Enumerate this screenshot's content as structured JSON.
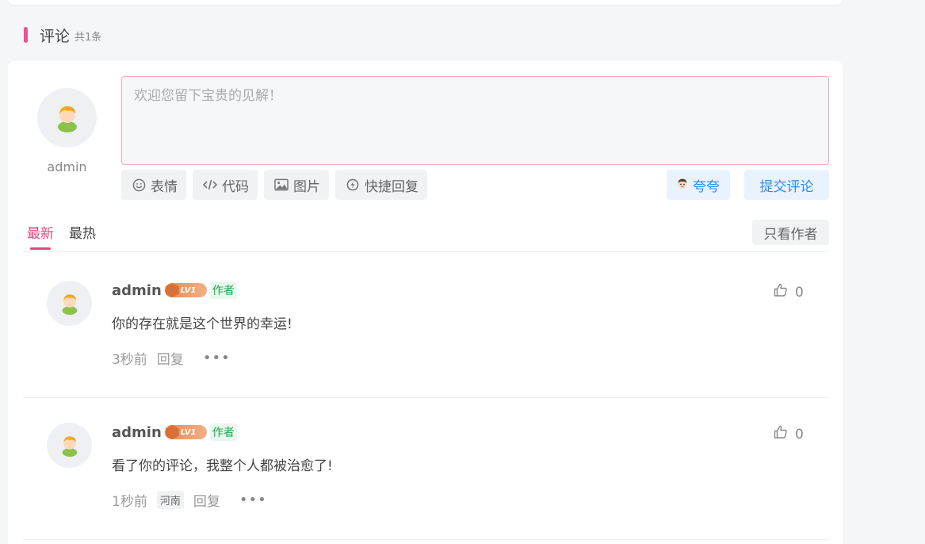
{
  "section": {
    "title": "评论",
    "count": "共1条"
  },
  "composer": {
    "user_name": "admin",
    "placeholder": "欢迎您留下宝贵的见解！",
    "tools": [
      {
        "icon": "smile-icon",
        "label": "表情"
      },
      {
        "icon": "code-icon",
        "label": "代码"
      },
      {
        "icon": "image-icon",
        "label": "图片"
      },
      {
        "icon": "quick-reply-icon",
        "label": "快捷回复"
      }
    ],
    "kuakua_label": "夸夸",
    "submit_label": "提交评论"
  },
  "sort": {
    "tabs": [
      "最新",
      "最热"
    ],
    "active": "最新",
    "only_author_label": "只看作者"
  },
  "comments": [
    {
      "author": "admin",
      "level": "LV1",
      "role_badge": "作者",
      "text": "你的存在就是这个世界的幸运!",
      "time": "3秒前",
      "region": "",
      "reply_label": "回复",
      "more": "•••",
      "likes": "0"
    },
    {
      "author": "admin",
      "level": "LV1",
      "role_badge": "作者",
      "text": "看了你的评论，我整个人都被治愈了!",
      "time": "1秒前",
      "region": "河南",
      "reply_label": "回复",
      "more": "•••",
      "likes": "0"
    }
  ],
  "colors": {
    "accent_pink": "#e8437f",
    "accent_blue": "#2d8cf0",
    "author_green": "#19a84a"
  }
}
